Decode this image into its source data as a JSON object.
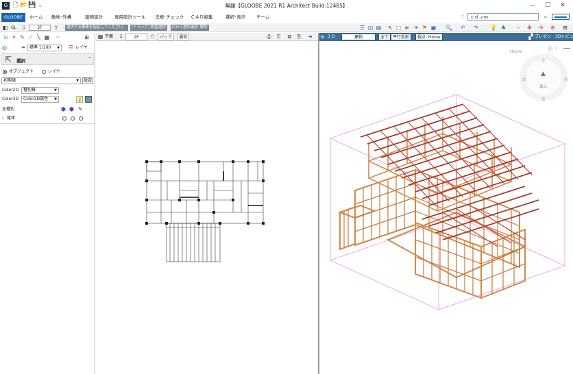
{
  "window": {
    "title": "無題【GLOOBE 2021 R1 Architect Build:12485】",
    "controls": [
      "—",
      "☐",
      "✕"
    ]
  },
  "ribbon": {
    "tabs": [
      "GLOOBE",
      "ホーム",
      "敷地･外構",
      "建物設計",
      "専用設計ツール",
      "法規･チェック",
      "ＣＡＤ編集",
      "選択･表示",
      "チーム"
    ],
    "search_value": "ｃｄ ｚｍ"
  },
  "toolbar": {
    "gl_label": "GL",
    "floor": "2F",
    "hints": [
      "選択する要素を指定してください。",
      "[ドラッグ] 範囲選択",
      "[Ctrl] 選択追加･解除"
    ]
  },
  "left_panel": {
    "scale": "標準 1/100",
    "layer_button": "レイヤ",
    "section_title": "選択",
    "radio_object": "オブジェクト",
    "radio_layer": "レイヤ",
    "initial_value": "初期値",
    "settings_button": "設定",
    "color2d_label": "Color2D",
    "color2d_value": "種別毎",
    "color3d_label": "Color3D",
    "color3d_value": "Color3D属性",
    "all_types": "全種別",
    "body_label": "躯体"
  },
  "plan_view": {
    "mode": "平面",
    "floor": "2F",
    "back": "バック",
    "normal": "通常"
  },
  "view3d": {
    "label": "3 D",
    "building": "建物",
    "all": "全て",
    "projection": "平行投影",
    "viewpoint": "視点: Home",
    "presen": "プレゼン",
    "render": "3Dレビュー",
    "nav_home": "Home",
    "nav_pages": [
      "1",
      "2"
    ],
    "compass": {
      "north": "北",
      "south": "南",
      "east": "東",
      "west": "西",
      "top": "真上"
    }
  },
  "colors": {
    "accent": "#1b64b5",
    "view3d_header": "#3f6f98",
    "timber": "#d0894a",
    "rafter": "#a83a2e",
    "bbox": "#e46ee4"
  }
}
